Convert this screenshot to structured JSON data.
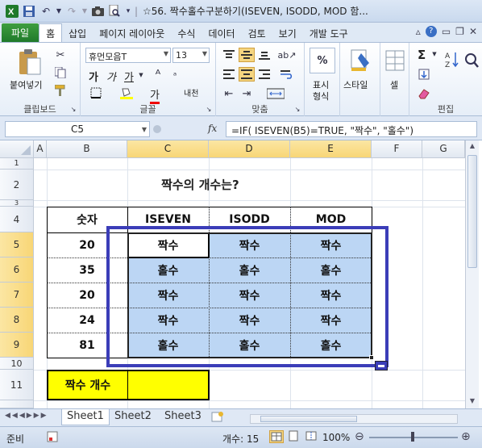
{
  "window": {
    "title": "☆56. 짝수홀수구분하기(ISEVEN, ISODD, MOD 함..."
  },
  "tabs": [
    "파일",
    "홈",
    "삽입",
    "페이지 레이아웃",
    "수식",
    "데이터",
    "검토",
    "보기",
    "개발 도구"
  ],
  "ribbon": {
    "clipboard": {
      "label": "클립보드",
      "paste": "붙여넣기"
    },
    "font": {
      "label": "글꼴",
      "name": "휴먼모음T",
      "size": "13",
      "bold": "가",
      "italic": "가",
      "underline": "가",
      "fontcolor": "가",
      "phonetic": "내천"
    },
    "align": {
      "label": "맞춤"
    },
    "number": {
      "label": "표시 형식",
      "line1": "표시",
      "line2": "형식",
      "percent": "%"
    },
    "style": {
      "label": "스타일"
    },
    "cells": {
      "label": "셀"
    },
    "edit": {
      "label": "편집",
      "sigma": "Σ"
    }
  },
  "formula_bar": {
    "name_box": "C5",
    "fx": "fx",
    "formula": "=IF( ISEVEN(B5)=TRUE, \"짝수\", \"홀수\")"
  },
  "columns": [
    "A",
    "B",
    "C",
    "D",
    "E",
    "F",
    "G"
  ],
  "rows": [
    "1",
    "2",
    "3",
    "4",
    "5",
    "6",
    "7",
    "8",
    "9",
    "10",
    "11"
  ],
  "sheet": {
    "title": "짝수의  개수는?",
    "headers": [
      "숫자",
      "ISEVEN",
      "ISODD",
      "MOD"
    ],
    "data": [
      {
        "num": "20",
        "iseven": "짝수",
        "isodd": "짝수",
        "mod": "짝수"
      },
      {
        "num": "35",
        "iseven": "홀수",
        "isodd": "홀수",
        "mod": "홀수"
      },
      {
        "num": "20",
        "iseven": "짝수",
        "isodd": "짝수",
        "mod": "짝수"
      },
      {
        "num": "24",
        "iseven": "짝수",
        "isodd": "짝수",
        "mod": "짝수"
      },
      {
        "num": "81",
        "iseven": "홀수",
        "isodd": "홀수",
        "mod": "홀수"
      }
    ],
    "count_label": "짝수  개수",
    "count_value": ""
  },
  "sheet_tabs": [
    "Sheet1",
    "Sheet2",
    "Sheet3"
  ],
  "status": {
    "ready": "준비",
    "count": "개수: 15",
    "zoom": "100%"
  },
  "colors": {
    "selection_fill": "#bcd6f4",
    "highlight_box": "#3b3db8",
    "count_fill": "#ffff00",
    "file_tab": "#2a8a34"
  }
}
